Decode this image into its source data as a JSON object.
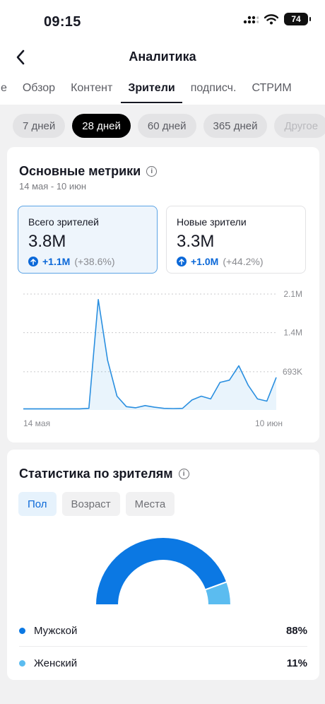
{
  "status": {
    "time": "09:15",
    "battery": "74"
  },
  "nav": {
    "title": "Аналитика"
  },
  "tabs": [
    {
      "label": "ие",
      "active": false
    },
    {
      "label": "Обзор",
      "active": false
    },
    {
      "label": "Контент",
      "active": false
    },
    {
      "label": "Зрители",
      "active": true
    },
    {
      "label": "подписч.",
      "active": false
    },
    {
      "label": "СТРИМ",
      "active": false
    }
  ],
  "ranges": [
    {
      "label": "7 дней"
    },
    {
      "label": "28 дней"
    },
    {
      "label": "60 дней"
    },
    {
      "label": "365 дней"
    },
    {
      "label": "Другое"
    }
  ],
  "metrics_card": {
    "title": "Основные метрики",
    "subtitle": "14 мая - 10 июн",
    "total": {
      "label": "Всего зрителей",
      "value": "3.8M",
      "change": "+1.1M",
      "change_pct": "(+38.6%)"
    },
    "new": {
      "label": "Новые зрители",
      "value": "3.3M",
      "change": "+1.0M",
      "change_pct": "(+44.2%)"
    }
  },
  "chart_data": {
    "type": "area",
    "series": [
      {
        "values": [
          20,
          20,
          20,
          20,
          20,
          20,
          20,
          30,
          2000,
          900,
          250,
          60,
          40,
          80,
          50,
          30,
          25,
          30,
          180,
          250,
          200,
          500,
          540,
          800,
          450,
          200,
          160,
          590
        ]
      }
    ],
    "x_tick_labels": [
      "14 мая",
      "10 июн"
    ],
    "y_ticks": [
      693000,
      1400000,
      2100000
    ],
    "y_tick_labels": [
      "693K",
      "1.4M",
      "2.1M"
    ],
    "ylim": [
      0,
      2100000
    ],
    "grid": true,
    "colors": {
      "line": "#2a8fe0",
      "fill": "#2a8fe0"
    }
  },
  "audience_card": {
    "title": "Статистика по зрителям",
    "segments": [
      {
        "label": "Пол",
        "active": true
      },
      {
        "label": "Возраст",
        "active": false
      },
      {
        "label": "Места",
        "active": false
      }
    ],
    "gender": [
      {
        "label": "Мужской",
        "value": "88%",
        "fraction": 0.88,
        "color": "#0b78e3"
      },
      {
        "label": "Женский",
        "value": "11%",
        "fraction": 0.11,
        "color": "#5bbcf0"
      }
    ]
  }
}
